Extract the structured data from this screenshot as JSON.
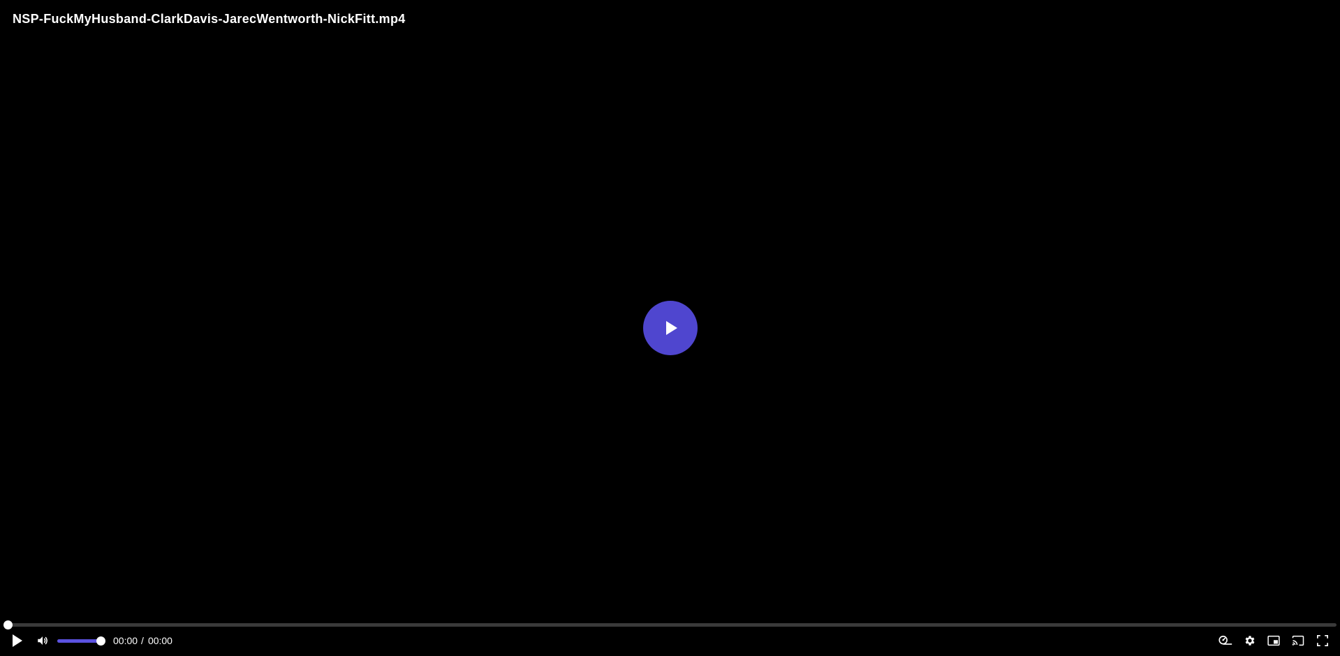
{
  "player": {
    "title": "NSP-FuckMyHusband-ClarkDavis-JarecWentworth-NickFitt.mp4",
    "accent_color": "#4f46cf",
    "progress_fraction": 0,
    "volume_fraction": 1,
    "time": {
      "current": "00:00",
      "separator": "/",
      "duration": "00:00"
    },
    "icons": {
      "big_play": "play-icon",
      "play": "play-icon",
      "volume": "volume-icon",
      "speed": "playback-speed-icon",
      "settings": "gear-icon",
      "pip": "picture-in-picture-icon",
      "cast": "cast-icon",
      "fullscreen": "fullscreen-icon"
    }
  }
}
